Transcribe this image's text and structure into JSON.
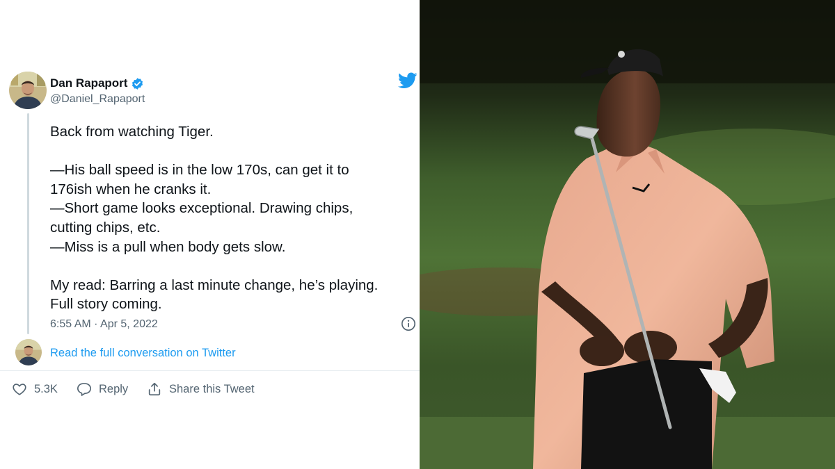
{
  "tweet": {
    "author": {
      "name": "Dan Rapaport",
      "handle": "@Daniel_Rapaport",
      "verified": true
    },
    "lines": [
      "Back from watching Tiger.",
      "",
      "—His ball speed is in the low 170s, can get it to",
      "176ish when he cranks it.",
      "—Short game looks exceptional. Drawing chips,",
      "cutting chips, etc.",
      "—Miss is a pull when body gets slow.",
      "",
      "My read: Barring a last minute change, he’s playing.",
      "Full story coming."
    ],
    "timestamp": "6:55 AM · Apr 5, 2022",
    "read_more_label": "Read the full conversation on Twitter",
    "actions": {
      "like_count": "5.3K",
      "reply_label": "Reply",
      "share_label": "Share this Tweet"
    }
  },
  "icons": {
    "verified": "verified-badge-icon",
    "brand": "twitter-bird-icon",
    "info": "info-icon",
    "like": "heart-icon",
    "reply": "speech-bubble-icon",
    "share": "share-icon"
  },
  "colors": {
    "accent": "#1d9bf0",
    "text_primary": "#0f1419",
    "text_secondary": "#536471",
    "thread_line": "#cfd9de",
    "divider": "#e6ecf0"
  }
}
